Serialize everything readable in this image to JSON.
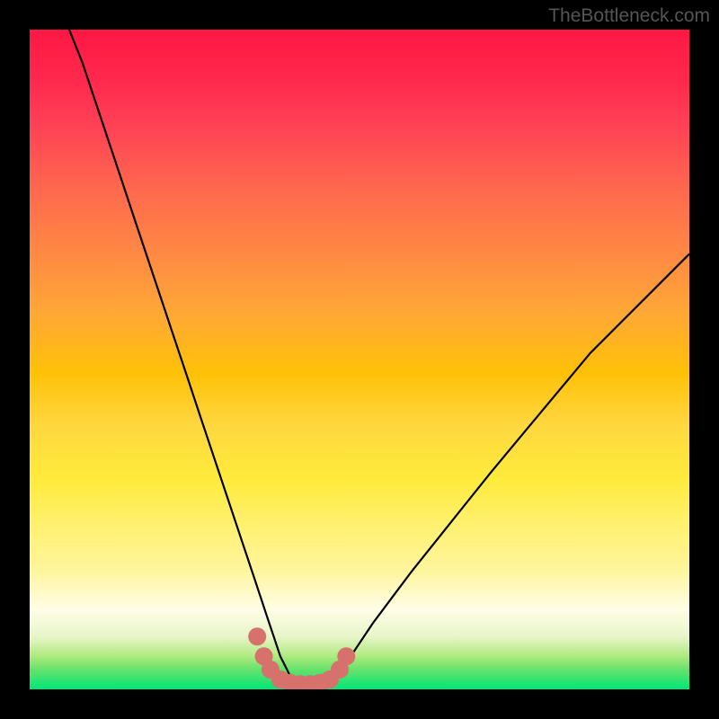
{
  "watermark": "TheBottleneck.com",
  "chart_data": {
    "type": "line",
    "title": "",
    "xlabel": "",
    "ylabel": "",
    "xlim": [
      0,
      100
    ],
    "ylim": [
      0,
      100
    ],
    "series": [
      {
        "name": "bottleneck-curve",
        "x": [
          6,
          8,
          10,
          12,
          14,
          16,
          18,
          20,
          22,
          24,
          26,
          28,
          30,
          32,
          34,
          35,
          36,
          37,
          38,
          39,
          40,
          41,
          42,
          43,
          44,
          45,
          46,
          48,
          50,
          52,
          55,
          58,
          62,
          66,
          70,
          75,
          80,
          85,
          90,
          95,
          100
        ],
        "y": [
          100,
          95,
          89,
          83,
          77,
          71,
          65,
          59,
          53,
          47,
          41,
          35,
          29,
          23,
          17,
          14,
          11,
          8,
          5,
          3,
          1,
          0,
          0,
          0,
          0,
          1,
          2,
          4,
          7,
          10,
          14,
          18,
          23,
          28,
          33,
          39,
          45,
          51,
          56,
          61,
          66
        ]
      }
    ],
    "markers": {
      "name": "marker-dots",
      "color": "#d6726b",
      "points": [
        {
          "x": 34.5,
          "y": 8
        },
        {
          "x": 35.5,
          "y": 5
        },
        {
          "x": 36.5,
          "y": 3
        },
        {
          "x": 38,
          "y": 1.5
        },
        {
          "x": 39.5,
          "y": 1
        },
        {
          "x": 41,
          "y": 0.8
        },
        {
          "x": 42.5,
          "y": 0.8
        },
        {
          "x": 44,
          "y": 1
        },
        {
          "x": 45.5,
          "y": 1.5
        },
        {
          "x": 47,
          "y": 3
        },
        {
          "x": 48,
          "y": 5
        }
      ]
    },
    "gradient_colors": {
      "top": "#ff1744",
      "mid_upper": "#ff8c42",
      "mid": "#ffeb3b",
      "mid_lower": "#fff59d",
      "bottom": "#00e676"
    }
  }
}
